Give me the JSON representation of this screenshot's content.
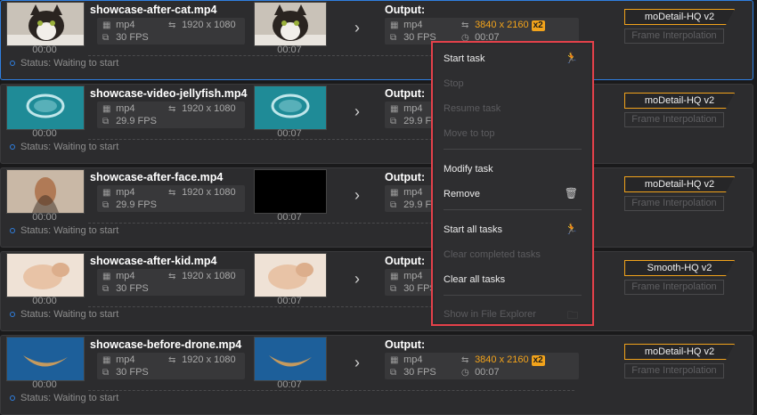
{
  "tasks": [
    {
      "name": "showcase-after-cat.mp4",
      "format": "mp4",
      "fps": "30 FPS",
      "resolution": "1920 x 1080",
      "duration": "00:00",
      "out_duration": "00:07",
      "output_label": "Output:",
      "out_format": "mp4",
      "out_fps": "30 FPS",
      "out_resolution": "3840 x 2160",
      "scale": "x2",
      "out_time": "00:07",
      "model": "moDetail-HQ  v2",
      "interp": "Frame Interpolation",
      "status": "Status: Waiting to start"
    },
    {
      "name": "showcase-video-jellyfish.mp4",
      "format": "mp4",
      "fps": "29.9 FPS",
      "resolution": "1920 x 1080",
      "duration": "00:00",
      "out_duration": "00:07",
      "output_label": "Output:",
      "out_format": "mp4",
      "out_fps": "29.9 FPS",
      "out_resolution": "",
      "scale": "",
      "out_time": "",
      "model": "moDetail-HQ  v2",
      "interp": "Frame Interpolation",
      "status": "Status: Waiting to start"
    },
    {
      "name": "showcase-after-face.mp4",
      "format": "mp4",
      "fps": "29.9 FPS",
      "resolution": "1920 x 1080",
      "duration": "00:00",
      "out_duration": "00:07",
      "output_label": "Output:",
      "out_format": "mp4",
      "out_fps": "29.9 FPS",
      "out_resolution": "",
      "scale": "",
      "out_time": "",
      "model": "moDetail-HQ  v2",
      "interp": "Frame Interpolation",
      "status": "Status: Waiting to start"
    },
    {
      "name": "showcase-after-kid.mp4",
      "format": "mp4",
      "fps": "30 FPS",
      "resolution": "1920 x 1080",
      "duration": "00:00",
      "out_duration": "00:07",
      "output_label": "Output:",
      "out_format": "mp4",
      "out_fps": "30 FPS",
      "out_resolution": "",
      "scale": "",
      "out_time": "",
      "model": "Smooth-HQ  v2",
      "interp": "Frame Interpolation",
      "status": "Status: Waiting to start"
    },
    {
      "name": "showcase-before-drone.mp4",
      "format": "mp4",
      "fps": "30 FPS",
      "resolution": "1920 x 1080",
      "duration": "00:00",
      "out_duration": "00:07",
      "output_label": "Output:",
      "out_format": "mp4",
      "out_fps": "30 FPS",
      "out_resolution": "3840 x 2160",
      "scale": "x2",
      "out_time": "00:07",
      "model": "moDetail-HQ  v2",
      "interp": "Frame Interpolation",
      "status": "Status: Waiting to start"
    }
  ],
  "menu": {
    "start_task": "Start task",
    "stop": "Stop",
    "resume_task": "Resume task",
    "move_to_top": "Move to top",
    "modify_task": "Modify task",
    "remove": "Remove",
    "start_all": "Start all tasks",
    "clear_completed": "Clear completed tasks",
    "clear_all": "Clear all tasks",
    "show_in_explorer": "Show in File Explorer"
  },
  "colors": {
    "accent": "#f2a31b",
    "selection": "#2f7fe0",
    "menu_border": "#e4414a"
  }
}
